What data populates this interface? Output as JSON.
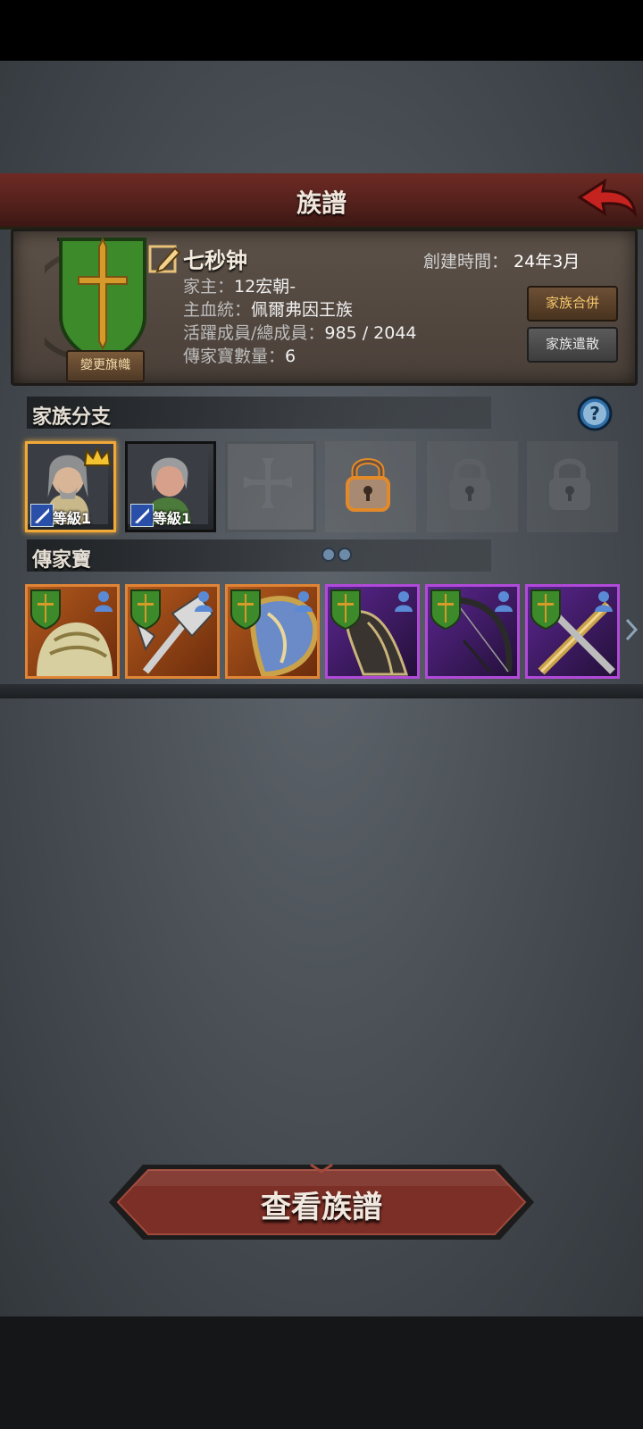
{
  "header": {
    "title": "族譜"
  },
  "family": {
    "name": "七秒钟",
    "created_label": "創建時間：",
    "created_value": "24年3月",
    "head_label": "家主：",
    "head_value": "12宏朝-",
    "bloodline_label": "主血統：",
    "bloodline_value": "佩爾弗因王族",
    "members_label": "活躍成員/總成員：",
    "members_value": "985 / 2044",
    "heirlooms_label": "傳家寶數量：",
    "heirlooms_value": "6",
    "change_banner_label": "變更旗幟",
    "merge_label": "家族合併",
    "disband_label": "家族遣散"
  },
  "branches": {
    "title": "家族分支",
    "slots": [
      {
        "type": "member",
        "level_label": "等級1",
        "leader": true
      },
      {
        "type": "member",
        "level_label": "等級1",
        "leader": false
      },
      {
        "type": "empty"
      },
      {
        "type": "locked-unlockable"
      },
      {
        "type": "locked"
      },
      {
        "type": "locked"
      }
    ]
  },
  "heirlooms": {
    "title": "傳家寶",
    "items": [
      {
        "name": "armor-icon",
        "rarity": "orange"
      },
      {
        "name": "halberd-icon",
        "rarity": "orange"
      },
      {
        "name": "shield-icon",
        "rarity": "orange"
      },
      {
        "name": "cloak-icon",
        "rarity": "purple"
      },
      {
        "name": "bow-icon",
        "rarity": "purple"
      },
      {
        "name": "crossed-swords-icon",
        "rarity": "purple"
      }
    ]
  },
  "footer": {
    "view_button_label": "查看族譜"
  },
  "colors": {
    "accent_red": "#6e2a24",
    "banner_green": "#3d8a2a",
    "cross_gold": "#d59a2a",
    "rarity_orange": "#e08536",
    "rarity_purple": "#b14ad9"
  }
}
